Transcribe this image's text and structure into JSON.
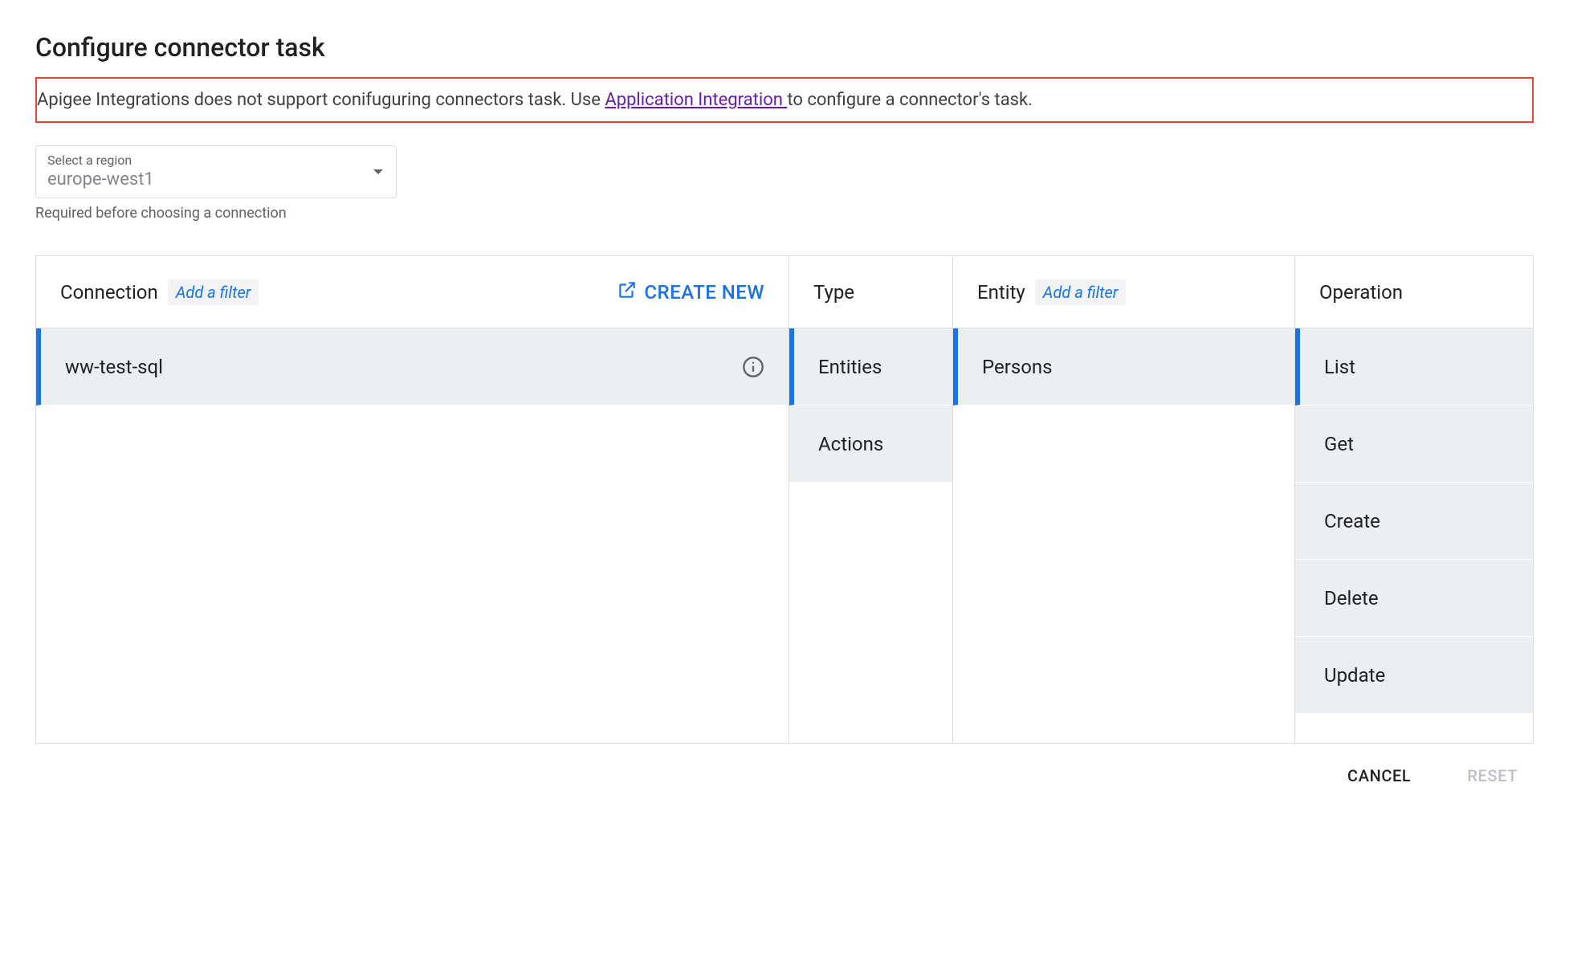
{
  "title": "Configure connector task",
  "warning": {
    "prefix": "Apigee Integrations does not support conifuguring connectors task. Use ",
    "link_text": "Application Integration ",
    "suffix": "to configure a connector's task."
  },
  "region": {
    "label": "Select a region",
    "value": "europe-west1",
    "helper": "Required before choosing a connection"
  },
  "columns": {
    "connection": {
      "header": "Connection",
      "filter_placeholder": "Add a filter",
      "create_new": "CREATE NEW",
      "items": [
        {
          "label": "ww-test-sql",
          "selected": true,
          "info": true
        }
      ]
    },
    "type": {
      "header": "Type",
      "items": [
        {
          "label": "Entities",
          "selected": true
        },
        {
          "label": "Actions",
          "selected": false
        }
      ]
    },
    "entity": {
      "header": "Entity",
      "filter_placeholder": "Add a filter",
      "items": [
        {
          "label": "Persons",
          "selected": true
        }
      ]
    },
    "operation": {
      "header": "Operation",
      "items": [
        {
          "label": "List",
          "selected": true
        },
        {
          "label": "Get",
          "selected": false
        },
        {
          "label": "Create",
          "selected": false
        },
        {
          "label": "Delete",
          "selected": false
        },
        {
          "label": "Update",
          "selected": false
        }
      ]
    }
  },
  "footer": {
    "cancel": "CANCEL",
    "reset": "RESET"
  }
}
